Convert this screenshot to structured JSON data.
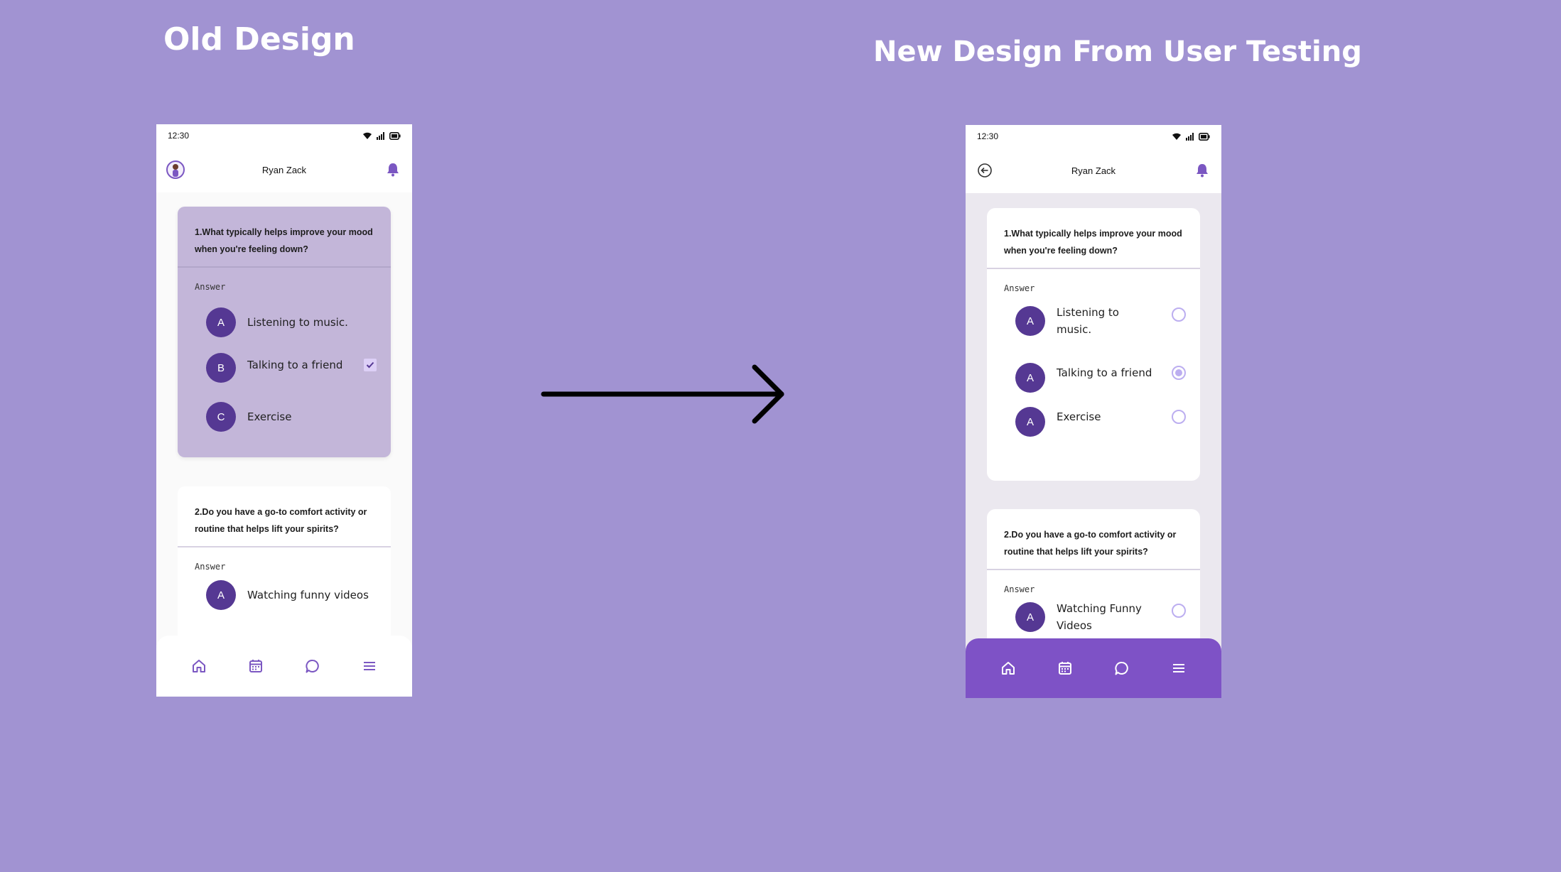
{
  "headings": {
    "old": "Old Design",
    "new": "New Design From User Testing"
  },
  "colors": {
    "background": "#a193d2",
    "accent": "#553893",
    "nav_new": "#7e52c6",
    "selected_card_old": "#c3b6d9"
  },
  "old": {
    "status": {
      "time": "12:30"
    },
    "appbar": {
      "title": "Ryan Zack",
      "left_icon": "avatar",
      "right_icon": "bell-icon"
    },
    "q1": {
      "question": "1.What typically helps improve your mood when you're feeling down?",
      "answer_label": "Answer",
      "options": [
        {
          "letter": "A",
          "text": "Listening to music."
        },
        {
          "letter": "B",
          "text": "Talking to a friend",
          "checked": true
        },
        {
          "letter": "C",
          "text": "Exercise"
        }
      ]
    },
    "q2": {
      "question": "2.Do you have a go-to comfort activity or routine that helps lift your spirits?",
      "answer_label": "Answer",
      "options": [
        {
          "letter": "A",
          "text": "Watching funny videos"
        }
      ]
    },
    "nav": [
      "home-icon",
      "calendar-icon",
      "chat-icon",
      "menu-icon"
    ]
  },
  "new": {
    "status": {
      "time": "12:30"
    },
    "appbar": {
      "title": "Ryan Zack",
      "left_icon": "back-arrow-icon",
      "right_icon": "bell-icon"
    },
    "q1": {
      "question": "1.What typically helps improve your mood when you're feeling down?",
      "answer_label": "Answer",
      "options": [
        {
          "letter": "A",
          "text": "Listening to music.",
          "selected": false
        },
        {
          "letter": "A",
          "text": "Talking to a friend",
          "selected": true
        },
        {
          "letter": "A",
          "text": "Exercise",
          "selected": false
        }
      ]
    },
    "q2": {
      "question": "2.Do you have a go-to comfort activity or routine that helps lift your spirits?",
      "answer_label": "Answer",
      "options": [
        {
          "letter": "A",
          "text": "Watching Funny Videos",
          "selected": false
        }
      ]
    },
    "nav": [
      "home-icon",
      "calendar-icon",
      "chat-icon",
      "menu-icon"
    ]
  }
}
